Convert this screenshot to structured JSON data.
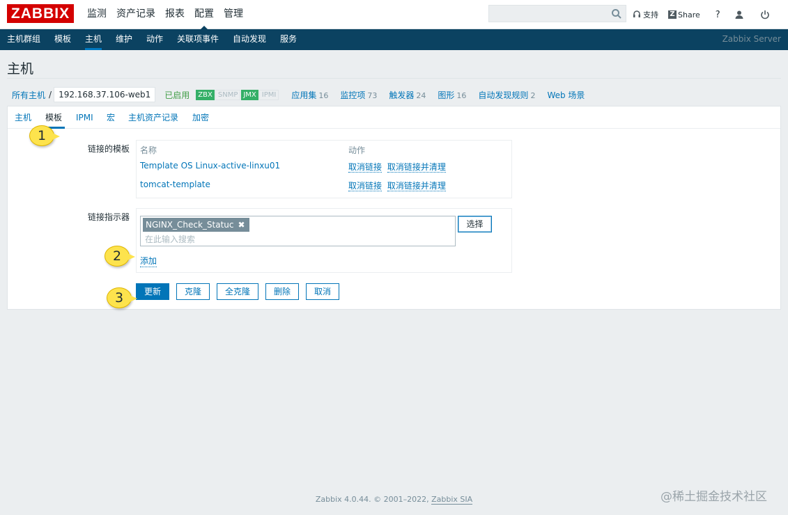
{
  "brand": {
    "logo": "ZABBIX",
    "color": "#d40000"
  },
  "main_menu": [
    "监测",
    "资产记录",
    "报表",
    "配置",
    "管理"
  ],
  "main_menu_active": "配置",
  "top_right": {
    "support": "支持",
    "share": "Share",
    "help": "?"
  },
  "sub_nav": [
    "主机群组",
    "模板",
    "主机",
    "维护",
    "动作",
    "关联项事件",
    "自动发现",
    "服务"
  ],
  "sub_nav_active": "主机",
  "server_name": "Zabbix Server",
  "page_title": "主机",
  "breadcrumb": {
    "all_hosts": "所有主机",
    "sep": "/",
    "host": "192.168.37.106-web1",
    "status": "已启用",
    "availability": [
      "ZBX",
      "SNMP",
      "JMX",
      "IPMI"
    ],
    "links": [
      {
        "label": "应用集",
        "count": "16"
      },
      {
        "label": "监控项",
        "count": "73"
      },
      {
        "label": "触发器",
        "count": "24"
      },
      {
        "label": "图形",
        "count": "16"
      },
      {
        "label": "自动发现规则",
        "count": "2"
      },
      {
        "label": "Web 场景",
        "count": ""
      }
    ]
  },
  "tabs": [
    "主机",
    "模板",
    "IPMI",
    "宏",
    "主机资产记录",
    "加密"
  ],
  "tab_active": "模板",
  "linked_templates": {
    "label": "链接的模板",
    "col_name": "名称",
    "col_action": "动作",
    "rows": [
      {
        "name": "Template OS Linux-active-linxu01",
        "unlink": "取消链接",
        "unlink_clear": "取消链接并清理"
      },
      {
        "name": "tomcat-template",
        "unlink": "取消链接",
        "unlink_clear": "取消链接并清理"
      }
    ]
  },
  "link_indicator": {
    "label": "链接指示器",
    "chip": "NGINX_Check_Statuc",
    "placeholder": "在此输入搜索",
    "select_button": "选择",
    "add": "添加"
  },
  "buttons": {
    "update": "更新",
    "clone": "克隆",
    "full_clone": "全克隆",
    "delete": "删除",
    "cancel": "取消"
  },
  "callouts": [
    "1",
    "2",
    "3"
  ],
  "footer": {
    "text": "Zabbix 4.0.44. © 2001–2022,",
    "company": "Zabbix SIA"
  },
  "watermark": "@稀土掘金技术社区"
}
